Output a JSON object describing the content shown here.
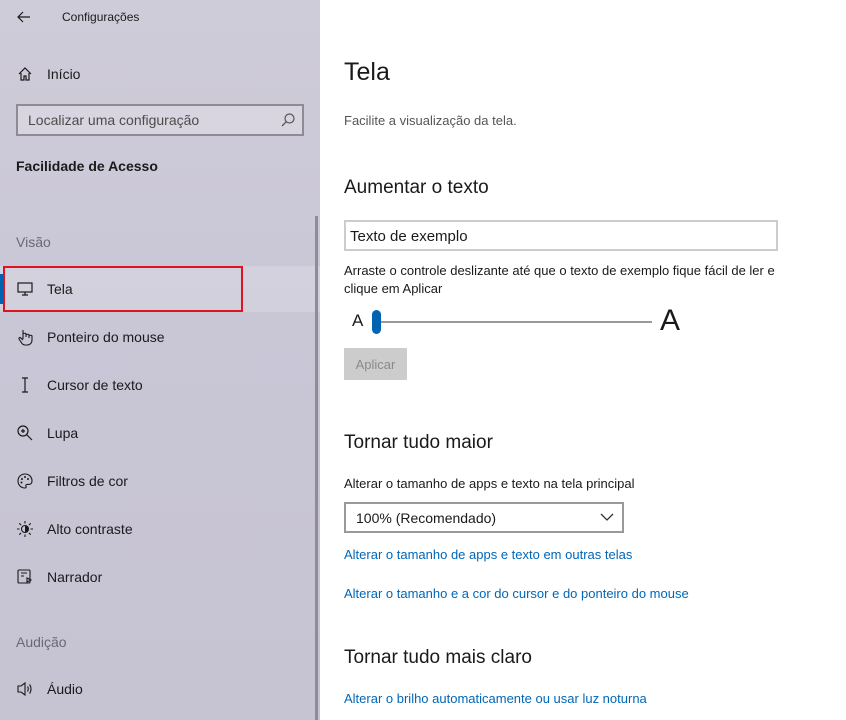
{
  "window": {
    "title": "Configurações"
  },
  "sidebar": {
    "home_label": "Início",
    "search_placeholder": "Localizar uma configuração",
    "section_title": "Facilidade de Acesso",
    "group_vision": "Visão",
    "group_audio": "Audição",
    "items": [
      {
        "label": "Tela",
        "icon": "monitor-icon",
        "selected": true
      },
      {
        "label": "Ponteiro do mouse",
        "icon": "mouse-pointer-icon"
      },
      {
        "label": "Cursor de texto",
        "icon": "text-cursor-icon"
      },
      {
        "label": "Lupa",
        "icon": "magnifier-icon"
      },
      {
        "label": "Filtros de cor",
        "icon": "color-palette-icon"
      },
      {
        "label": "Alto contraste",
        "icon": "brightness-icon"
      },
      {
        "label": "Narrador",
        "icon": "narrator-icon"
      }
    ],
    "audio_items": [
      {
        "label": "Áudio",
        "icon": "speaker-icon"
      }
    ]
  },
  "main": {
    "title": "Tela",
    "subtitle": "Facilite a visualização da tela.",
    "text_size": {
      "heading": "Aumentar o texto",
      "sample": "Texto de exemplo",
      "description": "Arraste o controle deslizante até que o texto de exemplo fique fácil de ler e clique em Aplicar",
      "slider_min_label": "A",
      "slider_max_label": "A",
      "slider_value": 0,
      "apply_label": "Aplicar"
    },
    "make_bigger": {
      "heading": "Tornar tudo maior",
      "label": "Alterar o tamanho de apps e texto na tela principal",
      "selected": "100% (Recomendado)",
      "link1": "Alterar o tamanho de apps e texto em outras telas",
      "link2": "Alterar o tamanho e a cor do cursor e do ponteiro do mouse"
    },
    "brighter": {
      "heading": "Tornar tudo mais claro",
      "link1": "Alterar o brilho automaticamente ou usar luz noturna"
    }
  },
  "colors": {
    "accent": "#0063b1",
    "link": "#0067b8",
    "highlight_box": "#e0141e"
  }
}
